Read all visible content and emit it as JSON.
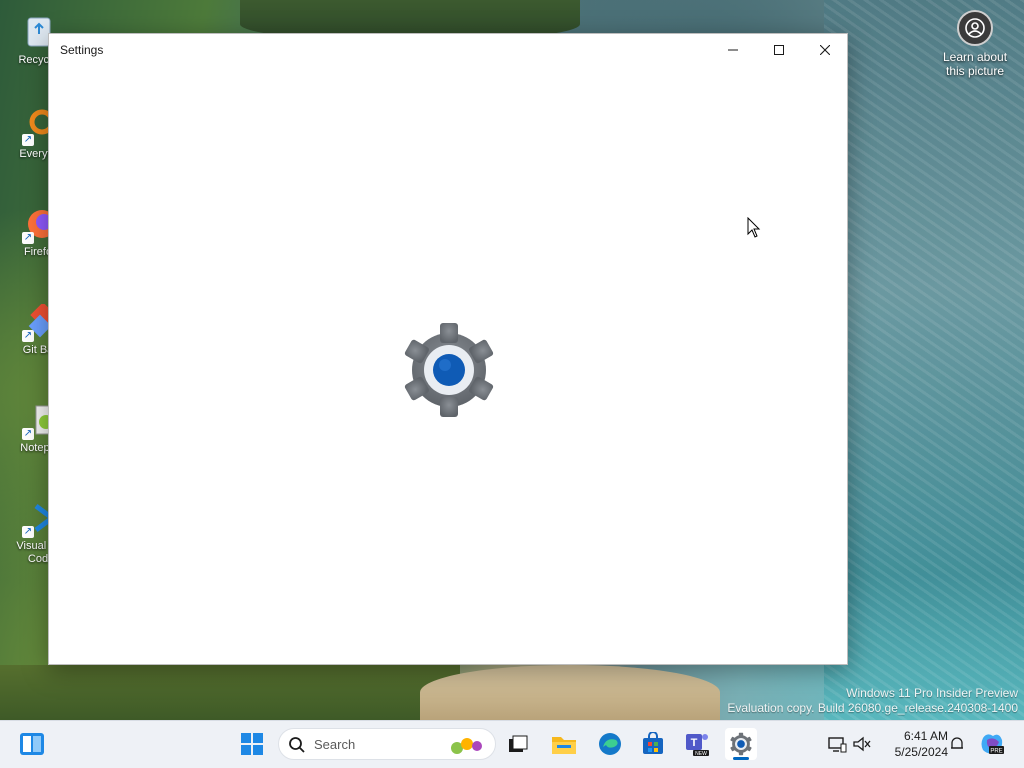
{
  "desktop": {
    "icons": [
      {
        "label": "Recycle",
        "icon": "recycle-bin-icon"
      },
      {
        "label": "Everyth",
        "icon": "everything-search-icon"
      },
      {
        "label": "Firefo",
        "icon": "firefox-icon"
      },
      {
        "label": "Git Ba",
        "icon": "git-bash-icon"
      },
      {
        "label": "Notepa",
        "icon": "notepad-plus-plus-icon"
      },
      {
        "label": "Visual St",
        "label2": "Cod",
        "icon": "vscode-icon"
      }
    ],
    "learn_label": "Learn about this picture",
    "watermark_line1": "Windows 11 Pro Insider Preview",
    "watermark_line2": "Evaluation copy. Build 26080.ge_release.240308-1400"
  },
  "window": {
    "title": "Settings",
    "controls": [
      "minimize-icon",
      "maximize-icon",
      "close-icon"
    ],
    "splash_icon": "settings-gear-icon"
  },
  "taskbar": {
    "search_placeholder": "Search",
    "apps": [
      "start-icon",
      "task-view-icon",
      "file-explorer-icon",
      "edge-icon",
      "store-icon",
      "teams-icon",
      "settings-gear-icon"
    ],
    "teams_badge": "NEW",
    "tray": [
      "network-icon",
      "volume-icon",
      "notification-icon",
      "copilot-icon"
    ],
    "copilot_badge": "PRE",
    "time": "6:41 AM",
    "date": "5/25/2024"
  },
  "colors": {
    "accent": "#0067c0",
    "gear_gray": "#6d7278",
    "gear_center": "#0f5bb5"
  }
}
